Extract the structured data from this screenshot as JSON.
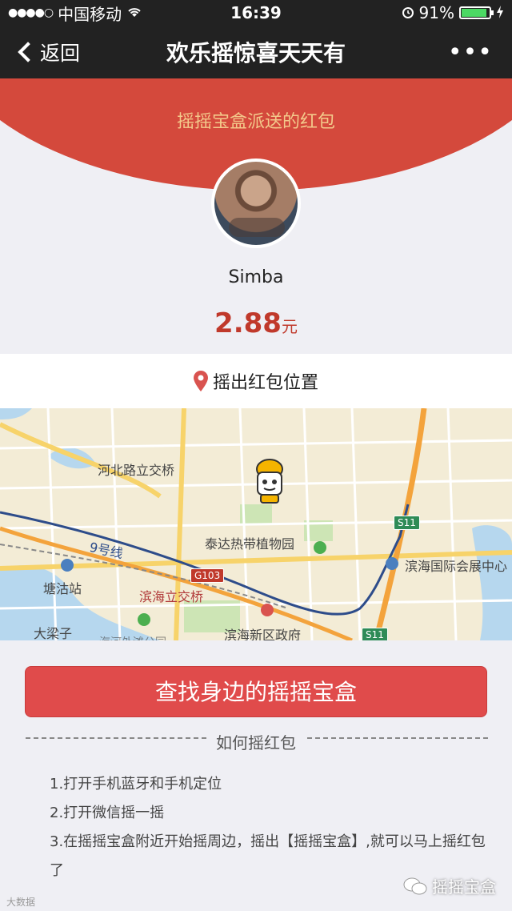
{
  "status_bar": {
    "carrier": "中国移动",
    "time": "16:39",
    "battery": "91%",
    "battery_level": 0.91
  },
  "nav": {
    "back_label": "返回",
    "title": "欢乐摇惊喜天天有",
    "more_label": "•••"
  },
  "envelope": {
    "subtitle": "摇摇宝盒派送的红包"
  },
  "user": {
    "name": "Simba"
  },
  "amount": {
    "value": "2.88",
    "unit": "元"
  },
  "location": {
    "label": "摇出红包位置"
  },
  "map": {
    "labels": [
      "河北路立交桥",
      "泰达热带植物园",
      "滨海国际会展中心",
      "塘沽站",
      "滨海立交桥",
      "大梁子",
      "滨海新区政府",
      "9号线",
      "海河外滩公园"
    ],
    "shields": [
      "G103",
      "S11",
      "S11"
    ],
    "colors": {
      "water": "#b6d7ee",
      "road_main": "#f3a33c",
      "metro": "#2d4c8a"
    }
  },
  "actions": {
    "find_button": "查找身边的摇摇宝盒"
  },
  "help": {
    "title": "如何摇红包",
    "steps": [
      "1.打开手机蓝牙和手机定位",
      "2.打开微信摇一摇",
      "3.在摇摇宝盒附近开始摇周边，摇出【摇摇宝盒】,就可以马上摇红包了"
    ]
  },
  "watermark": {
    "left": "大数据",
    "right": "摇摇宝盒"
  },
  "colors": {
    "header_bg": "#222222",
    "envelope_red": "#d4493c",
    "button_red": "#e04b4b",
    "amount_red": "#c0392b",
    "subtitle_gold": "#f3c98b"
  }
}
